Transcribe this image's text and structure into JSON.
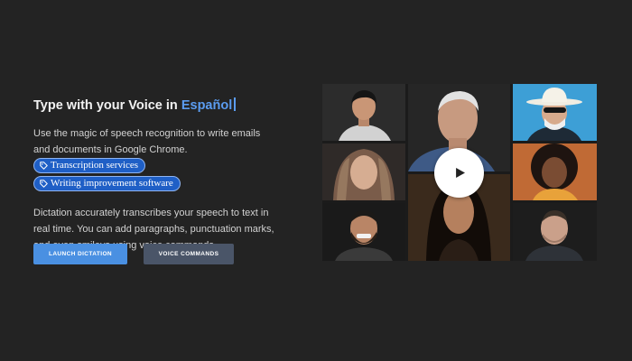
{
  "hero": {
    "headline_prefix": "Type with your Voice in ",
    "headline_language": "Español",
    "intro_text": "Use the magic of speech recognition to write emails and documents in Google Chrome.",
    "tags": [
      {
        "label": "Transcription services",
        "icon": "tag-icon"
      },
      {
        "label": "Writing improvement software",
        "icon": "tag-icon"
      }
    ],
    "detail_text": "Dictation accurately transcribes your speech to text in real time. You can add paragraphs, punctuation marks, and even smileys using voice commands."
  },
  "buttons": {
    "primary_label": "LAUNCH DICTATION",
    "secondary_label": "VOICE COMMANDS"
  },
  "gallery": {
    "play_icon": "play-icon",
    "tiles": [
      {
        "subject": "young man in light shirt"
      },
      {
        "subject": "elderly man in blue shirt"
      },
      {
        "subject": "man with white cowboy hat and sunglasses"
      },
      {
        "subject": "woman wearing patterned headscarf"
      },
      {
        "subject": "woman with curly hair"
      },
      {
        "subject": "smiling bearded man"
      },
      {
        "subject": "woman with long dark hair"
      },
      {
        "subject": "man with short hair and stubble"
      }
    ]
  },
  "colors": {
    "background": "#232323",
    "accent": "#5b9cf0",
    "chip": "#1f5fc6",
    "primary_button": "#4a90e2",
    "secondary_button": "#4a5568"
  }
}
